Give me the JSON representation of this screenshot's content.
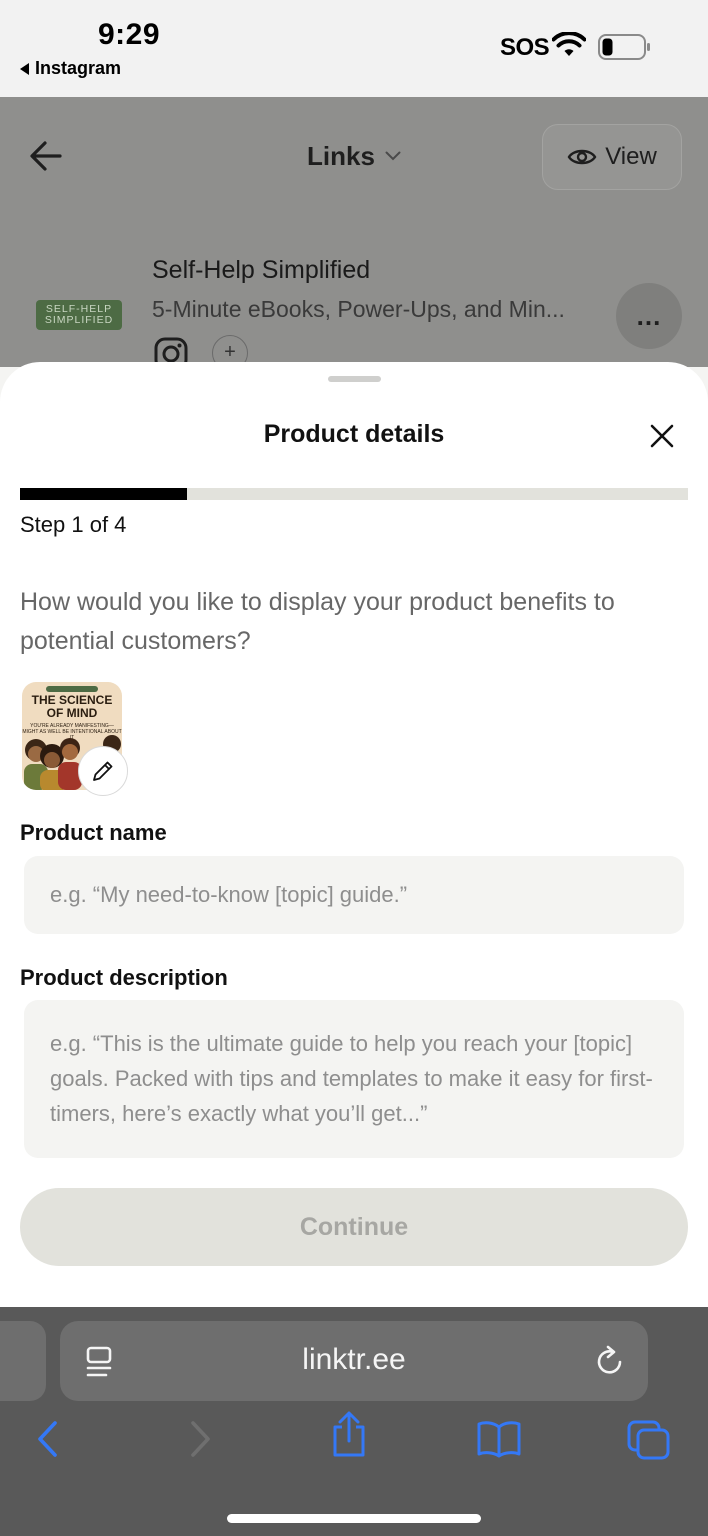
{
  "status_bar": {
    "time": "9:29",
    "back_app": "Instagram",
    "sos": "SOS"
  },
  "app_header": {
    "title": "Links",
    "view_label": "View"
  },
  "profile": {
    "logo_text": "SELF-HELP SIMPLIFIED",
    "name": "Self-Help Simplified",
    "tagline": "5-Minute eBooks, Power-Ups, and Min...",
    "more_label": "..."
  },
  "sheet": {
    "title": "Product details",
    "progress": {
      "current_step": 1,
      "total_steps": 4,
      "fraction": 0.25
    },
    "step_text": "Step 1 of 4",
    "question": "How would you like to display your product benefits to potential customers?",
    "product_image": {
      "cover_title": "THE SCIENCE OF MIND",
      "cover_subtitle": "YOU'RE ALREADY MANIFESTING— MIGHT AS WELL BE INTENTIONAL ABOUT IT"
    },
    "product_name_label": "Product name",
    "product_name_placeholder": "e.g. “My need-to-know [topic] guide.”",
    "product_name_value": "",
    "product_description_label": "Product description",
    "product_description_placeholder": "e.g. “This is the ultimate guide to help you reach your [topic] goals. Packed with tips and templates to make it easy for first-timers, here’s exactly what you’ll get...”",
    "product_description_value": "",
    "continue_label": "Continue"
  },
  "browser": {
    "url": "linktr.ee"
  },
  "colors": {
    "accent_blue": "#3478f6",
    "progress_fill": "#000000",
    "progress_track": "#e2e2dc",
    "button_disabled_bg": "#e2e2dc",
    "button_disabled_text": "#a7a7a3",
    "logo_green": "#4d6b44"
  },
  "icons": [
    "back-arrow-icon",
    "chevron-down-icon",
    "eye-icon",
    "more-icon",
    "instagram-icon",
    "plus-icon",
    "close-icon",
    "pencil-icon",
    "reader-icon",
    "reload-icon",
    "safari-back-icon",
    "safari-forward-icon",
    "share-icon",
    "bookmarks-icon",
    "tabs-icon",
    "wifi-icon",
    "battery-icon"
  ]
}
